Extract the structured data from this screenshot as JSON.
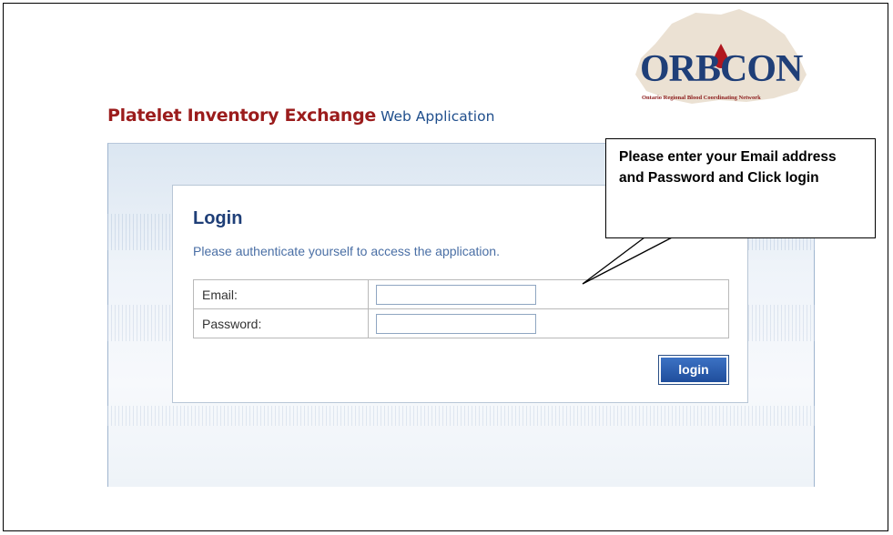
{
  "logo": {
    "text": "ORBCON",
    "tagline": "Ontario Regional Blood Coordinating Network"
  },
  "header": {
    "title_bold": "Platelet Inventory Exchange",
    "title_rest": "Web Application"
  },
  "login": {
    "title": "Login",
    "subtitle": "Please authenticate yourself to access the application.",
    "fields": [
      {
        "label": "Email:",
        "value": ""
      },
      {
        "label": "Password:",
        "value": ""
      }
    ],
    "button_label": "login"
  },
  "callout": {
    "text": "Please enter your Email address and Password and Click login"
  },
  "colors": {
    "title_red": "#9b1c1c",
    "brand_blue": "#1f3f78",
    "button_blue": "#2a5ca8"
  }
}
